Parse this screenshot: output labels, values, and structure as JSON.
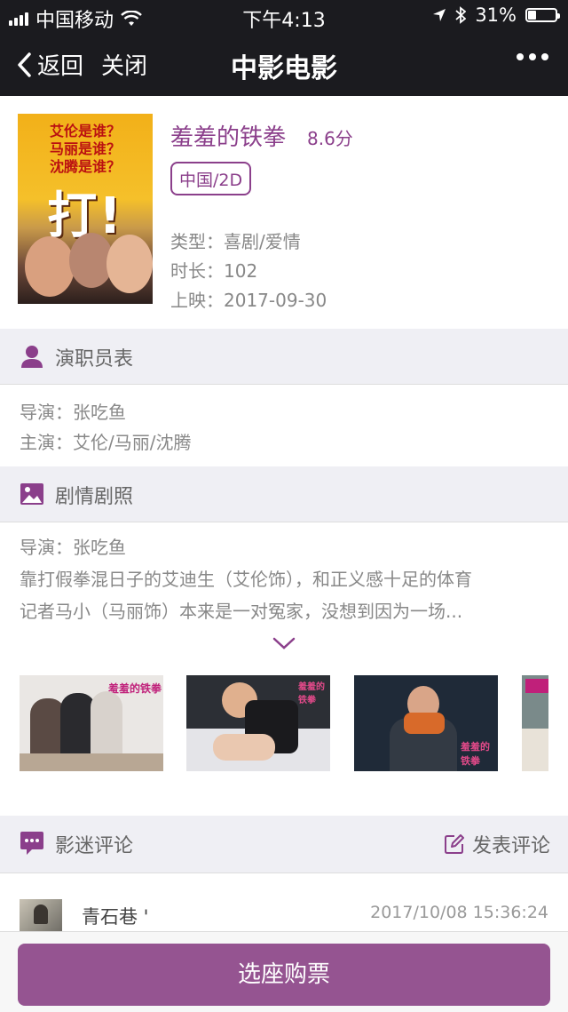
{
  "status_bar": {
    "carrier": "中国移动",
    "time": "下午4:13",
    "battery": "31%",
    "battery_level": 0.31
  },
  "nav": {
    "back_label": "返回",
    "close_label": "关闭",
    "title": "中影电影"
  },
  "poster_text": {
    "line1": "艾伦是谁？",
    "line2": "马丽是谁？",
    "line3": "沈腾是谁？",
    "big": "打!"
  },
  "movie": {
    "title": "羞羞的铁拳",
    "score": "8.6分",
    "tag": "中国/2D",
    "type": "类型：喜剧/爱情",
    "duration": "时长：102",
    "release": "上映：2017-09-30"
  },
  "cast": {
    "heading": "演职员表",
    "director": "导演：张吃鱼",
    "actors": "主演：艾伦/马丽/沈腾"
  },
  "plot": {
    "heading": "剧情剧照",
    "director": "导演：张吃鱼",
    "line1": "靠打假拳混日子的艾迪生（艾伦饰），和正义感十足的体育",
    "line2": "记者马小（马丽饰）本来是一对冤家，没想到因为一场..."
  },
  "stills_logo": "羞羞的铁拳",
  "comments": {
    "heading": "影迷评论",
    "post_label": "发表评论",
    "items": [
      {
        "user": "青石巷 '",
        "time": "2017/10/08 15:36:24"
      }
    ]
  },
  "footer": {
    "buy_label": "选座购票"
  },
  "colors": {
    "accent": "#8b3f8b",
    "button": "#955491",
    "nav_bg": "#1b1b1f"
  }
}
